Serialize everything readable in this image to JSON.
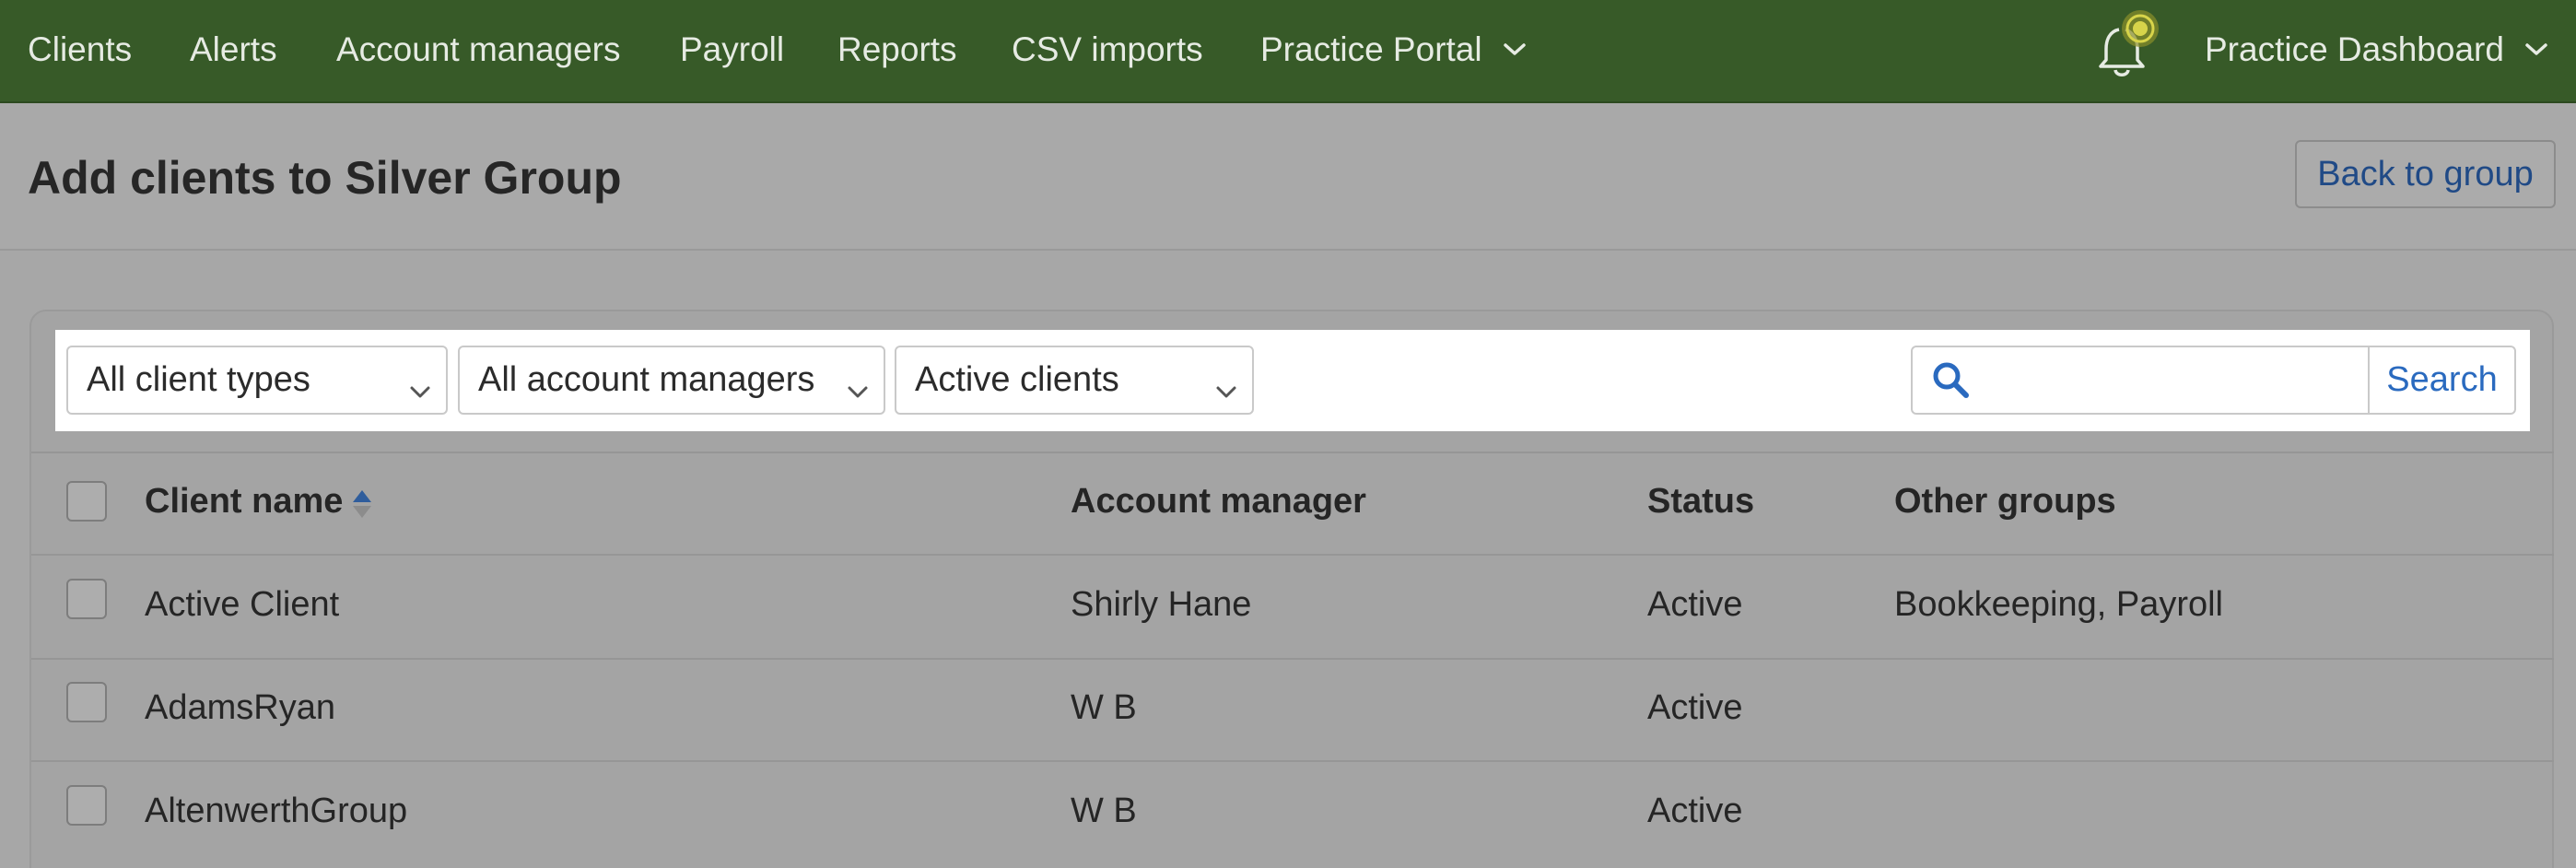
{
  "nav": {
    "items": [
      "Clients",
      "Alerts",
      "Account managers",
      "Payroll",
      "Reports",
      "CSV imports"
    ],
    "portal_label": "Practice Portal",
    "dashboard_label": "Practice Dashboard",
    "bell_icon": "notification-bell-icon"
  },
  "header": {
    "title": "Add clients to Silver Group",
    "back_label": "Back to group"
  },
  "filters": {
    "client_type": "All client types",
    "account_manager": "All account managers",
    "status": "Active clients",
    "search_placeholder": "",
    "search_label": "Search"
  },
  "table": {
    "columns": [
      "Client name",
      "Account manager",
      "Status",
      "Other groups"
    ],
    "rows": [
      {
        "name": "Active Client",
        "manager": "Shirly Hane",
        "status": "Active",
        "groups": "Bookkeeping, Payroll"
      },
      {
        "name": "AdamsRyan",
        "manager": "W B",
        "status": "Active",
        "groups": ""
      },
      {
        "name": "AltenwerthGroup",
        "manager": "W B",
        "status": "Active",
        "groups": ""
      }
    ]
  },
  "colors": {
    "nav_bg": "#375a28",
    "link_blue": "#204a86",
    "search_blue": "#2a6abf",
    "overlay_bg": "#a7a7a7"
  }
}
